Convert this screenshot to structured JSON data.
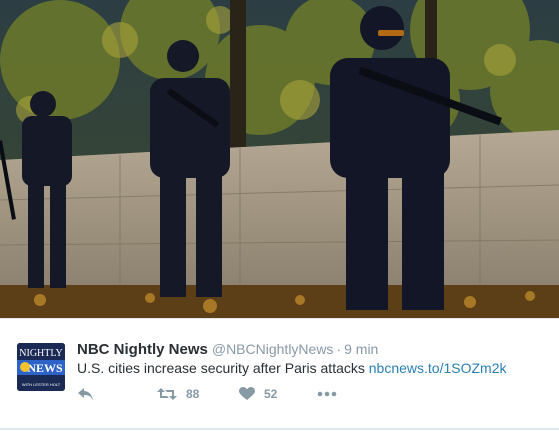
{
  "photo": {
    "description_icon": "photo-icon",
    "colors": {
      "sky": "#1d2a33",
      "foliage": "#5f6f28",
      "wall": "#9b8f7d",
      "ground": "#6b4a1b",
      "uniform": "#121626"
    }
  },
  "tweet": {
    "author_name": "NBC Nightly News",
    "handle": "@NBCNightlyNews",
    "separator": "·",
    "time": "9 min",
    "text": "U.S. cities increase security after Paris attacks",
    "link": "nbcnews.to/1SOZm2k",
    "avatar": {
      "line1": "NIGHTLY",
      "line2": "NEWS",
      "line3": "WITH LESTER HOLT"
    },
    "actions": {
      "reply_icon": "reply-icon",
      "retweet_icon": "retweet-icon",
      "retweet_count": "88",
      "like_icon": "heart-icon",
      "like_count": "52",
      "more_icon": "more-icon"
    },
    "colors": {
      "text": "#292f33",
      "muted": "#8899a6",
      "link": "#2a7fb3"
    }
  }
}
